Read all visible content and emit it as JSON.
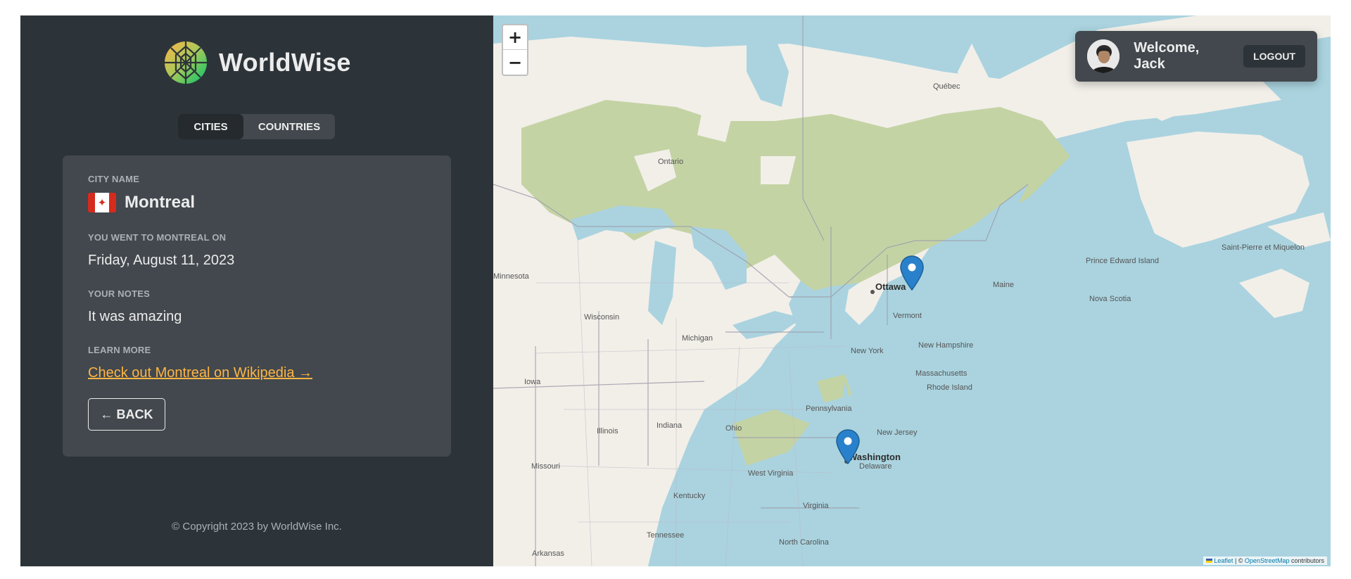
{
  "app": {
    "name": "WorldWise"
  },
  "tabs": [
    {
      "label": "CITIES",
      "active": true
    },
    {
      "label": "COUNTRIES",
      "active": false
    }
  ],
  "city": {
    "name_label": "CITY NAME",
    "name": "Montreal",
    "flag": "canada-flag",
    "date_label": "YOU WENT TO MONTREAL ON",
    "date": "Friday, August 11, 2023",
    "notes_label": "YOUR NOTES",
    "notes": "It was amazing",
    "learn_label": "LEARN MORE",
    "wiki_link": "Check out Montreal on Wikipedia →",
    "back": "← BACK"
  },
  "footer": "© Copyright 2023 by WorldWise Inc.",
  "user": {
    "welcome": "Welcome, Jack",
    "logout": "LOGOUT"
  },
  "map": {
    "zoom_in": "+",
    "zoom_out": "−",
    "markers": [
      "ottawa-marker",
      "washington-marker"
    ],
    "labels": {
      "ottawa": "Ottawa",
      "washington": "Washington",
      "ontario": "Ontario",
      "quebec": "Québec",
      "minnesota": "Minnesota",
      "wisconsin": "Wisconsin",
      "michigan": "Michigan",
      "iowa": "Iowa",
      "illinois": "Illinois",
      "indiana": "Indiana",
      "ohio": "Ohio",
      "missouri": "Missouri",
      "kentucky": "Kentucky",
      "west_virginia": "West Virginia",
      "virginia": "Virginia",
      "tennessee": "Tennessee",
      "north_carolina": "North Carolina",
      "arkansas": "Arkansas",
      "pennsylvania": "Pennsylvania",
      "new_york": "New York",
      "new_jersey": "New Jersey",
      "delaware": "Delaware",
      "vermont": "Vermont",
      "new_hampshire": "New Hampshire",
      "massachusetts": "Massachusetts",
      "rhode_island": "Rhode Island",
      "maine": "Maine",
      "nova_scotia": "Nova Scotia",
      "pei": "Prince Edward Island",
      "spm": "Saint-Pierre et Miquelon"
    },
    "attribution": {
      "leaflet": "Leaflet",
      "sep": " | © ",
      "osm": "OpenStreetMap",
      "tail": " contributors"
    }
  },
  "colors": {
    "sidebar": "#2d3439",
    "card": "#42484d",
    "accent": "#ffb545",
    "water": "#aad3df",
    "land": "#f2efe9",
    "forest": "#b7c69a",
    "marker": "#2a81cb"
  }
}
